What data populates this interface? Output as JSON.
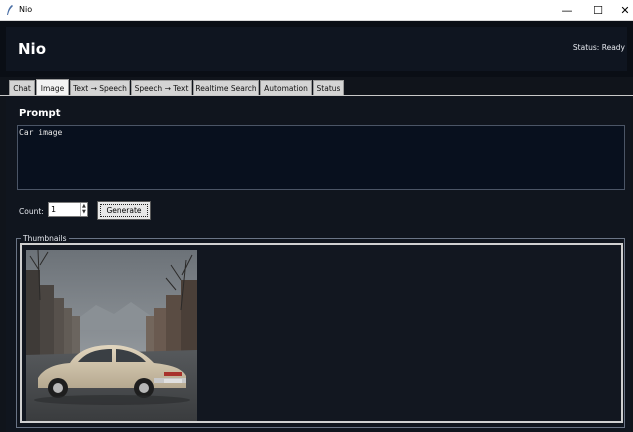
{
  "window": {
    "title": "Nio",
    "controls": {
      "minimize": "—",
      "maximize": "☐",
      "close": "✕"
    }
  },
  "header": {
    "app_name": "Nio",
    "status": "Status: Ready"
  },
  "tabs": [
    {
      "label": "Chat"
    },
    {
      "label": "Image",
      "active": true
    },
    {
      "label": "Text → Speech"
    },
    {
      "label": "Speech → Text"
    },
    {
      "label": "Realtime Search"
    },
    {
      "label": "Automation"
    },
    {
      "label": "Status"
    }
  ],
  "image_tab": {
    "prompt_title": "Prompt",
    "prompt_value": "Car image",
    "count_label": "Count:",
    "count_value": "1",
    "generate_label": "Generate",
    "thumbnails_label": "Thumbnails",
    "thumbnails": [
      {
        "icon": "car-photo-thumbnail"
      }
    ]
  },
  "colors": {
    "background": "#10141b",
    "header": "#0a0e15",
    "prompt_bg": "#08101e"
  }
}
